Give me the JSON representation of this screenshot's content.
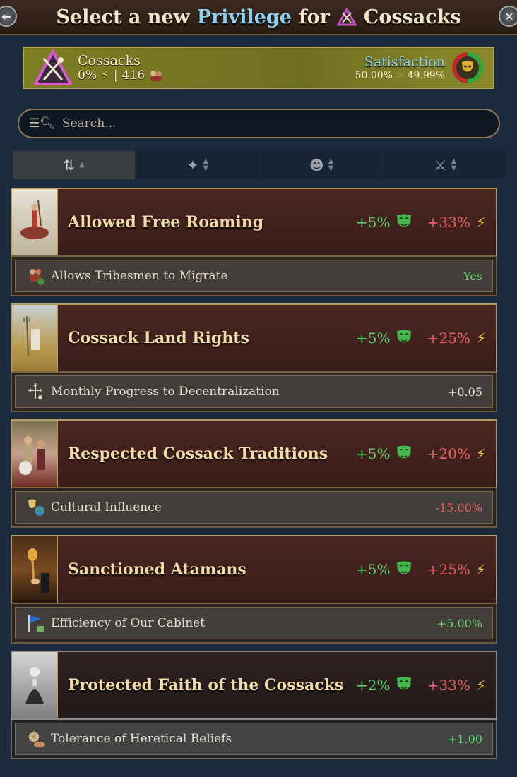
{
  "header": {
    "title_pre": "Select a new",
    "title_highlight": "Privilege",
    "title_for": "for",
    "title_estate": "Cossacks"
  },
  "estate": {
    "name": "Cossacks",
    "influence": "0%",
    "separator": "|",
    "population": "416",
    "satisfaction_label": "Satisfaction",
    "satisfaction_current": "50.00%",
    "satisfaction_arrow": ">",
    "satisfaction_next": "49.99%"
  },
  "search": {
    "placeholder": "Search..."
  },
  "sort_tabs": [
    {
      "icon": "alphabetical-sort-icon",
      "active": true
    },
    {
      "icon": "compass-star-icon",
      "active": false
    },
    {
      "icon": "mask-icon",
      "active": false
    },
    {
      "icon": "crossed-swords-icon",
      "active": false
    }
  ],
  "privileges": [
    {
      "name": "Allowed Free Roaming",
      "satisfaction": "+5%",
      "influence": "+33%",
      "effect_label": "Allows Tribesmen to Migrate",
      "effect_value": "Yes",
      "effect_sign": "pos"
    },
    {
      "name": "Cossack Land Rights",
      "satisfaction": "+5%",
      "influence": "+25%",
      "effect_label": "Monthly Progress to Decentralization",
      "effect_value": "+0.05",
      "effect_sign": "neu"
    },
    {
      "name": "Respected Cossack Traditions",
      "satisfaction": "+5%",
      "influence": "+20%",
      "effect_label": "Cultural Influence",
      "effect_value": "-15.00%",
      "effect_sign": "neg"
    },
    {
      "name": "Sanctioned Atamans",
      "satisfaction": "+5%",
      "influence": "+25%",
      "effect_label": "Efficiency of Our Cabinet",
      "effect_value": "+5.00%",
      "effect_sign": "pos"
    },
    {
      "name": "Protected Faith of the Cossacks",
      "satisfaction": "+2%",
      "influence": "+33%",
      "effect_label": "Tolerance of Heretical Beliefs",
      "effect_value": "+1.00",
      "effect_sign": "pos"
    }
  ],
  "colors": {
    "positive": "#5ed36a",
    "negative": "#ef5f61",
    "highlight": "#8fd0ee",
    "gold_border": "#b39a5e"
  }
}
